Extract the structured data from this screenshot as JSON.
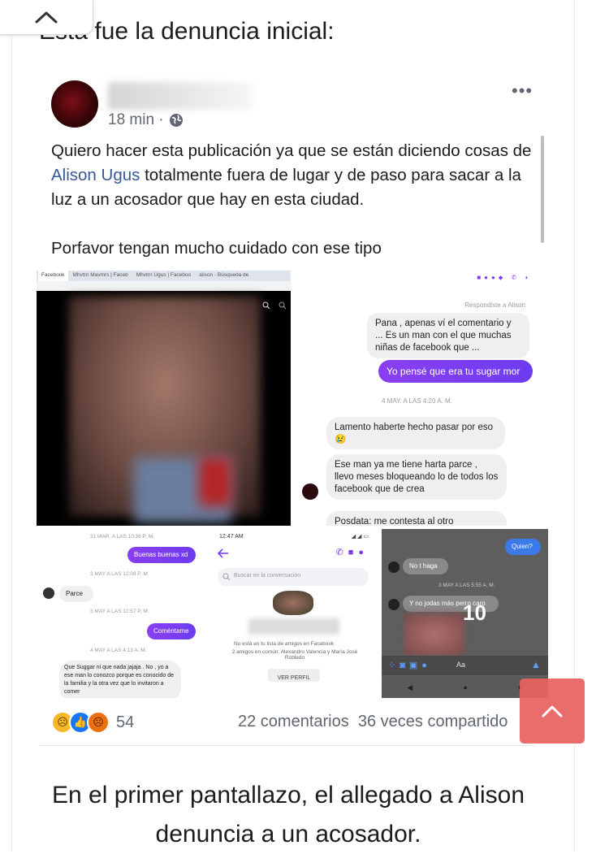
{
  "intro_text": "Esta fue la denuncia inicial:",
  "post": {
    "time": "18 min ·",
    "paragraph1_before": "Quiero hacer esta publicación ya que se están diciendo cosas de ",
    "mention": "Alison Ugus",
    "paragraph1_after": " totalmente fuera de lugar y de paso para sacar a la luz a un acosador que hay en esta ciudad.",
    "paragraph2": "Porfavor tengan mucho cuidado con ese tipo",
    "reaction_count": "54",
    "comments": "22 comentarios",
    "shares": "36 veces compartido"
  },
  "screenshots": {
    "browser": {
      "tab1": "Facebook",
      "tab2": "Mhvtrn Mavmrs | Faceb",
      "tab3": "Mhvtrn Ugus | Faceboo",
      "tab4": "alison - Búsqueda de"
    },
    "chat1": {
      "reply_note": "Respondiste a Alison",
      "quoted": "Pana , apenas ví el comentario y ... Es un man con el que muchas niñas de facebook que ...",
      "sent": "Yo pensé que era tu sugar mor",
      "date": "4 MAY. A LAS 4:20 A. M.",
      "msg1": "Lamento haberte hecho pasar por eso 😢",
      "msg2": "Ese man ya me tiene harta parce , llevo meses bloqueando lo de todos los facebook que de crea",
      "msg3": "Posdata: me contesta al otro"
    },
    "chat2": {
      "date1": "31 MAR. A LAS 10:36 P. M.",
      "sent1": "Buenas buenas xd",
      "date2": "3 MAY A LAS 12:08 P. M.",
      "recv1": "Parce",
      "date3": "3 MAY A LAS 12:57 P. M.",
      "sent2": "Coméntame",
      "date4": "4 MAY A LAS 4:13 A. M.",
      "recv2": "Que Suggar ni que nada jajaja . No , yo a ese man lo conozco porque es conocido de la familia y la otra vez que lo invitaron a comer"
    },
    "chat3": {
      "status_time": "12:47 AM",
      "search_placeholder": "Buscar en la conversación",
      "not_friends": "No está en tu lista de amigos en Facebook",
      "mutual": "2 amigos en común: Alexandro Valencia y María José Robledo",
      "view_profile": "VER PERFIL"
    },
    "chat4": {
      "sent": "Quien?",
      "recv1": "No t haga",
      "date": "3 MAY A LAS 5:55 A. M.",
      "recv2": "Y no jodas más perro caro",
      "overlay": "10",
      "compose": "Aa"
    }
  },
  "caption": "En el primer pantallazo, el allegado a Alison denuncia a un acosador.",
  "colors": {
    "mention": "#385898",
    "messenger_purple": "#7c3aed",
    "scroll_button": "#e8625f"
  }
}
